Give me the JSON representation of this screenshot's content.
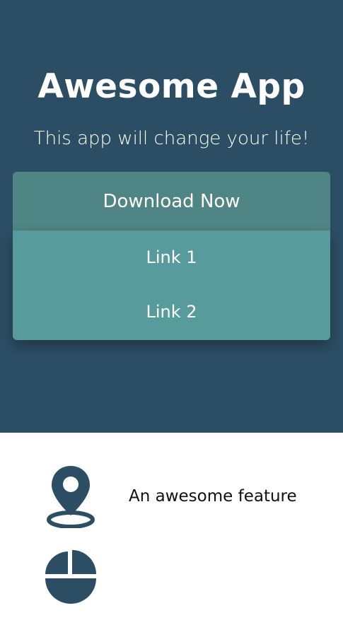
{
  "app": {
    "title": "Awesome App",
    "tagline": "This app will change your life!"
  },
  "download": {
    "label": "Download Now",
    "links": [
      "Link 1",
      "Link 2"
    ]
  },
  "features": [
    {
      "label": "An awesome feature",
      "icon": "location-pin-icon"
    },
    {
      "label": "",
      "icon": "pie-chart-icon"
    }
  ],
  "colors": {
    "hero_bg": "#2c4e64",
    "button_bg": "#4f8584",
    "dropdown_bg": "#579b9c",
    "icon": "#2c4e64"
  }
}
